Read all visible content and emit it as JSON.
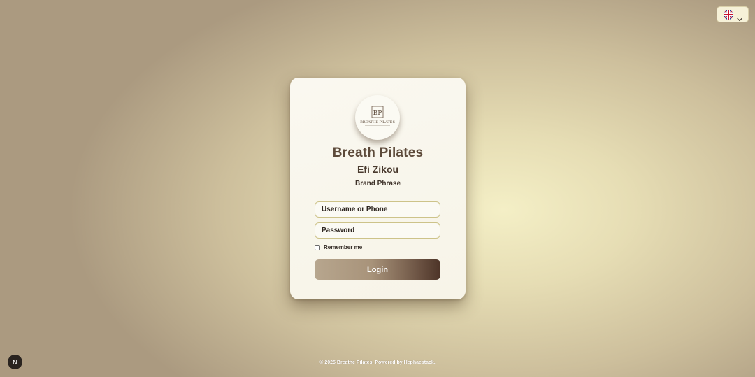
{
  "language_switcher": {
    "flag_icon": "uk-flag-icon",
    "chevron_icon": "chevron-down-icon"
  },
  "login_card": {
    "logo": {
      "monogram": "BP",
      "caption": "BREATHE PILATES"
    },
    "brand_title": "Breath Pilates",
    "owner_name": "Efi Zikou",
    "brand_phrase": "Brand Phrase",
    "username_placeholder": "Username or Phone",
    "password_placeholder": "Password",
    "remember_label": "Remember me",
    "login_label": "Login"
  },
  "footer": {
    "text": "© 2025 Breathe Pilates. Powered by Hephaestack."
  },
  "dev_badge": {
    "label": "N"
  },
  "colors": {
    "title_brown": "#5d4a3a",
    "button_dark": "#4d3428",
    "field_border": "#cdc38a"
  }
}
